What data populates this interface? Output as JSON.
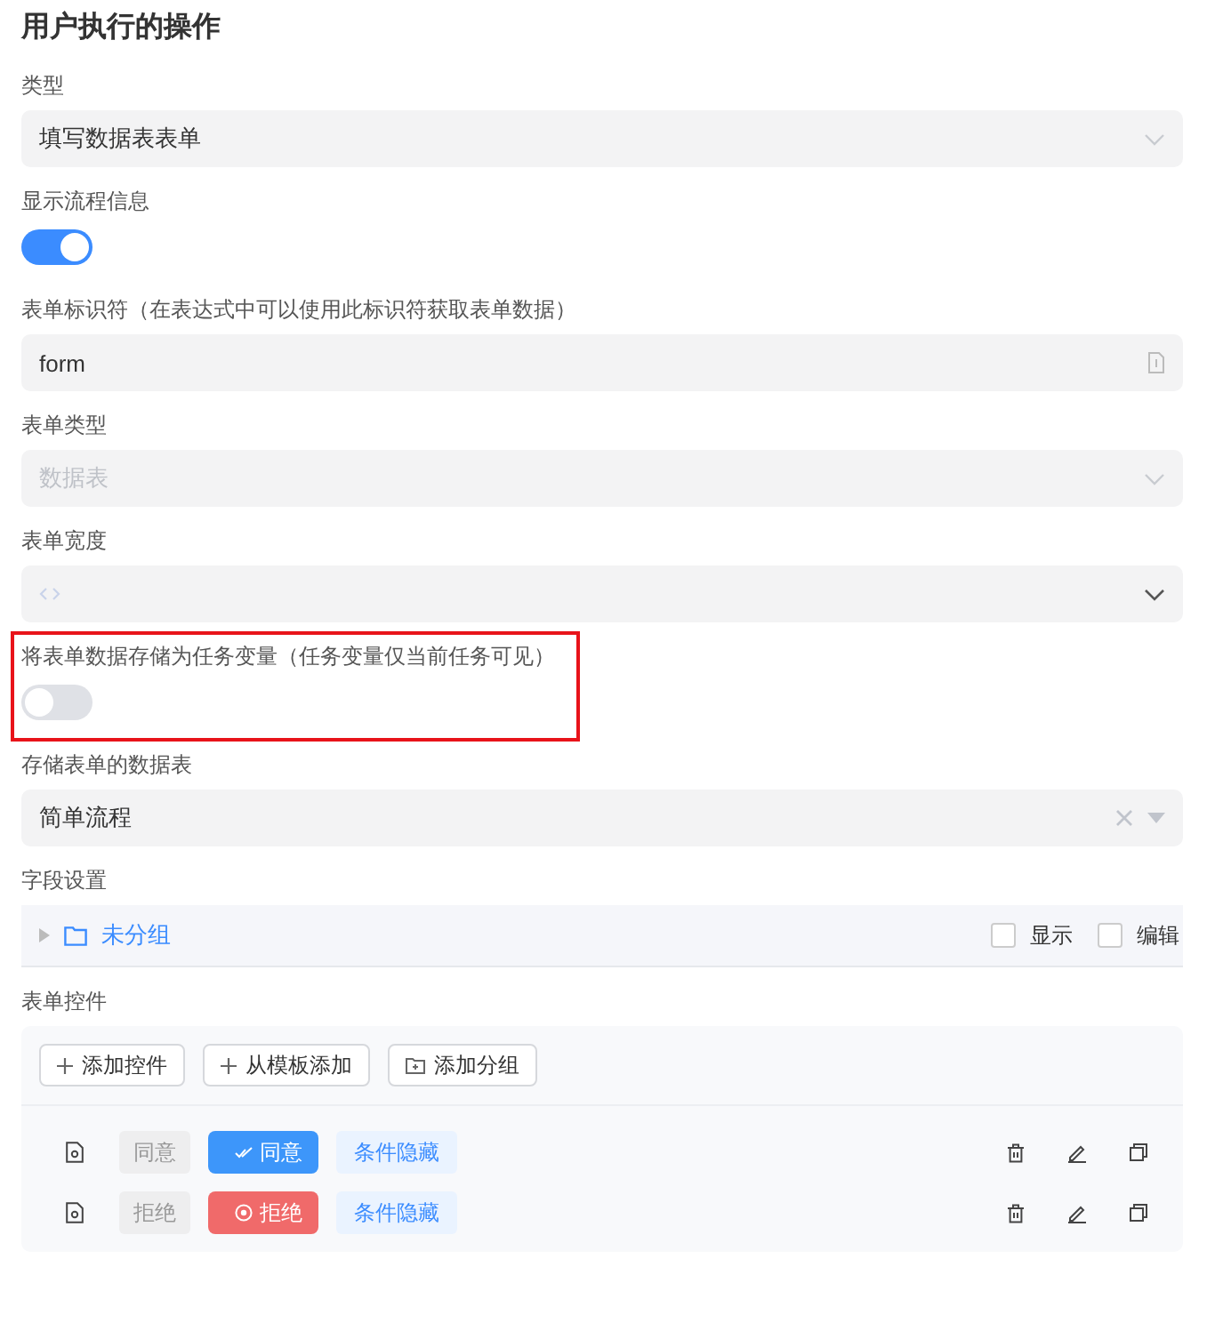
{
  "title": "用户执行的操作",
  "fields": [
    {
      "kind": "select",
      "label": "类型",
      "value": "填写数据表表单",
      "clearable": false,
      "highlighted": false
    },
    {
      "kind": "toggle",
      "label": "显示流程信息",
      "on": true,
      "highlighted": false
    },
    {
      "kind": "input",
      "label": "表单标识符（在表达式中可以使用此标识符获取表单数据）",
      "value": "form",
      "highlighted": false
    },
    {
      "kind": "select",
      "label": "表单类型",
      "placeholder": "数据表",
      "clearable": false,
      "highlighted": false
    },
    {
      "kind": "code_select",
      "label": "表单宽度",
      "highlighted": false
    },
    {
      "kind": "toggle",
      "label": "将表单数据存储为任务变量（任务变量仅当前任务可见）",
      "on": false,
      "highlighted": true
    },
    {
      "kind": "select",
      "label": "存储表单的数据表",
      "value": "简单流程",
      "clearable": true,
      "highlighted": false
    }
  ],
  "field_settings": {
    "label": "字段设置",
    "group": {
      "name": "未分组",
      "expanded": false,
      "show_label": "显示",
      "show_checked": false,
      "edit_label": "编辑",
      "edit_checked": false
    }
  },
  "form_controls": {
    "label": "表单控件",
    "toolbar": [
      {
        "kind": "plus",
        "label": "添加控件"
      },
      {
        "kind": "plus",
        "label": "从模板添加"
      },
      {
        "kind": "folder",
        "label": "添加分组"
      }
    ],
    "rows": [
      {
        "name": "同意",
        "button": {
          "kind": "approve",
          "label": "同意"
        },
        "tag": "条件隐藏"
      },
      {
        "name": "拒绝",
        "button": {
          "kind": "reject",
          "label": "拒绝"
        },
        "tag": "条件隐藏"
      }
    ]
  }
}
